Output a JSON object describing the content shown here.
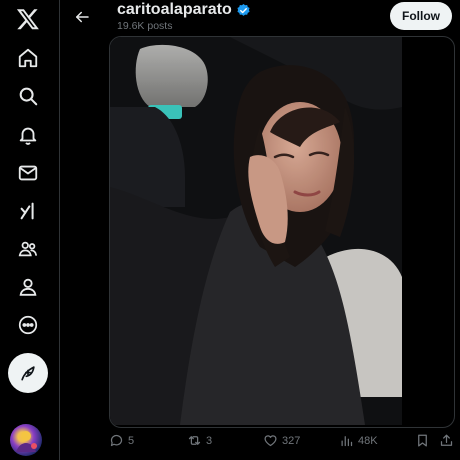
{
  "profile": {
    "name": "caritoalaparato",
    "posts_count": "19.6K posts",
    "verified": true,
    "follow_label": "Follow"
  },
  "post": {
    "stats": {
      "replies": "5",
      "reposts": "3",
      "likes": "327",
      "views": "48K"
    }
  },
  "colors": {
    "background": "#000000",
    "accent_blue": "#1d9bf0",
    "muted_text": "#71767b",
    "border": "#2f3336",
    "button_light": "#eff3f4"
  },
  "icons": {
    "sidebar": [
      "x-logo-icon",
      "home-icon",
      "search-icon",
      "bell-icon",
      "mail-icon",
      "grok-icon",
      "communities-icon",
      "profile-icon",
      "more-icon",
      "compose-icon"
    ],
    "actions": [
      "reply-icon",
      "repost-icon",
      "like-icon",
      "views-icon",
      "bookmark-icon",
      "share-icon"
    ]
  }
}
